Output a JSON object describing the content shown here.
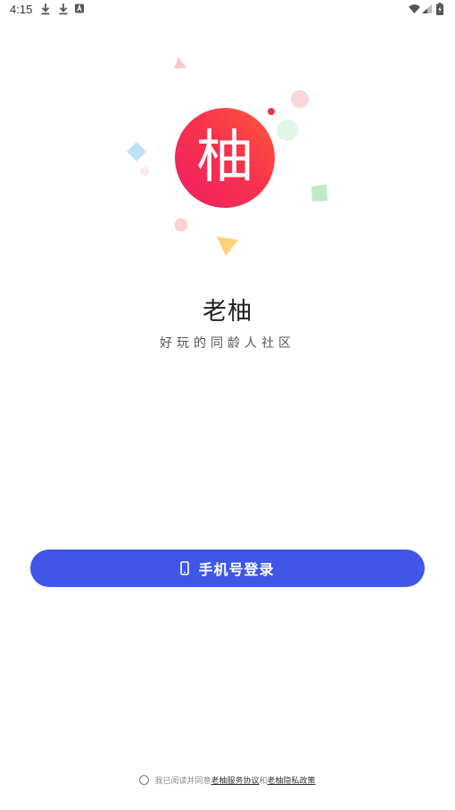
{
  "status_bar": {
    "time": "4:15",
    "left_icons": [
      "download-icon",
      "download-icon",
      "app-notification-icon"
    ],
    "right_icons": [
      "wifi-icon",
      "cell-signal-icon",
      "battery-charging-icon"
    ]
  },
  "logo": {
    "glyph": "柚",
    "colors": {
      "gradient_start": "#ff5a3c",
      "gradient_mid": "#f7334c",
      "gradient_end": "#ef2064"
    }
  },
  "app": {
    "name": "老柚",
    "slogan": "好玩的同龄人社区"
  },
  "login": {
    "button_label": "手机号登录",
    "icon": "phone-icon",
    "color": "#3f56e6"
  },
  "agreement": {
    "prefix": "我已阅读并同意",
    "service_link": "老柚服务协议",
    "joiner": "和",
    "privacy_link": "老柚隐私政策"
  }
}
